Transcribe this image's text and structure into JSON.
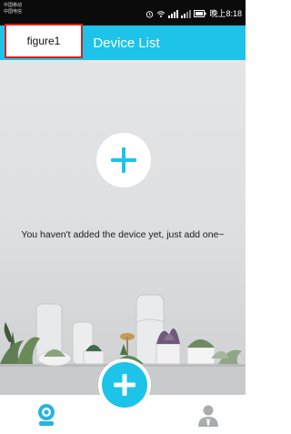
{
  "colors": {
    "accent": "#1ec3ea",
    "status_bar": "#0b0b0b",
    "figure_label_border": "#d4231c"
  },
  "status_bar": {
    "carrier_line_1": "中国移动",
    "carrier_line_2": "中国电信",
    "time": "晚上8:18",
    "icons": [
      "alarm-icon",
      "wifi-icon",
      "signal-icon",
      "signal-icon",
      "battery-icon"
    ]
  },
  "header": {
    "title": "Device List"
  },
  "figure_label": "figure1",
  "empty_state": {
    "add_icon": "plus-icon",
    "message": "You haven't added the device yet, just add one~"
  },
  "tab_bar": {
    "items": [
      {
        "icon": "camera-device-icon"
      },
      {
        "icon": "plus-icon"
      },
      {
        "icon": "user-profile-icon"
      }
    ]
  }
}
